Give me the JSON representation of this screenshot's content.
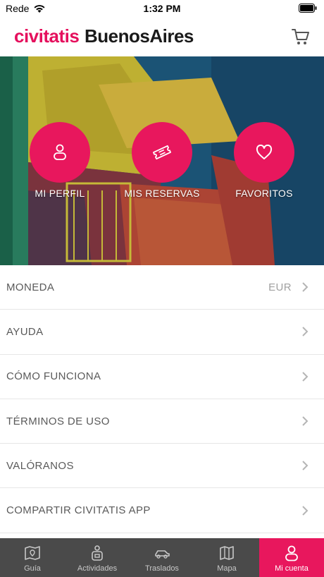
{
  "status_bar": {
    "carrier": "Rede",
    "time": "1:32 PM"
  },
  "header": {
    "brand": "civitatis",
    "city": "BuenosAires",
    "cart_icon": "cart-icon"
  },
  "hero": {
    "actions": [
      {
        "label": "MI PERFIL",
        "icon": "user-icon"
      },
      {
        "label": "MIS RESERVAS",
        "icon": "ticket-icon"
      },
      {
        "label": "FAVORITOS",
        "icon": "heart-icon"
      }
    ]
  },
  "menu": {
    "items": [
      {
        "label": "MONEDA",
        "value": "EUR"
      },
      {
        "label": "AYUDA",
        "value": ""
      },
      {
        "label": "CÓMO FUNCIONA",
        "value": ""
      },
      {
        "label": "TÉRMINOS DE USO",
        "value": ""
      },
      {
        "label": "VALÓRANOS",
        "value": ""
      },
      {
        "label": "COMPARTIR CIVITATIS APP",
        "value": ""
      }
    ]
  },
  "tabbar": {
    "tabs": [
      {
        "label": "Guía",
        "icon": "map-guide-icon"
      },
      {
        "label": "Actividades",
        "icon": "activities-icon"
      },
      {
        "label": "Traslados",
        "icon": "transfer-icon"
      },
      {
        "label": "Mapa",
        "icon": "map-icon"
      },
      {
        "label": "Mi cuenta",
        "icon": "account-icon"
      }
    ],
    "active_index": 4
  },
  "colors": {
    "brand": "#e5105d",
    "accent": "#e8175d",
    "tabbar_bg": "#4a4a4a"
  }
}
